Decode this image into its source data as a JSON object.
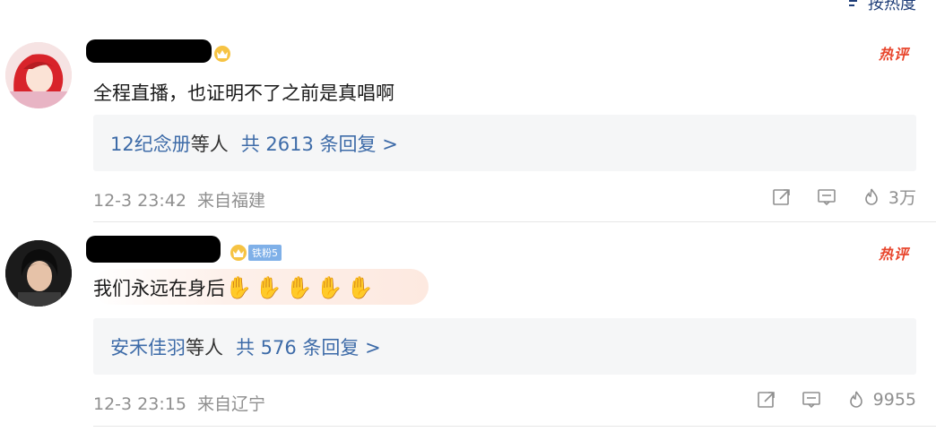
{
  "sort": {
    "label": "按热度"
  },
  "comments": [
    {
      "hot_label": "热评",
      "text": "全程直播，也证明不了之前是真唱啊",
      "reply_names": "12纪念册",
      "reply_suffix": "等人",
      "reply_count_label": "共 2613 条回复 >",
      "time": "12-3 23:42",
      "location": "来自福建",
      "likes": "3万"
    },
    {
      "hot_label": "热评",
      "fan_badge": "铁粉5",
      "text": "我们永远在身后",
      "emoji": "✋",
      "reply_names": "安禾佳羽",
      "reply_suffix": "等人",
      "reply_count_label": "共 576 条回复 >",
      "time": "12-3 23:15",
      "location": "来自辽宁",
      "likes": "9955"
    }
  ],
  "colors": {
    "link": "#3d6ba8",
    "hot": "#e8452c",
    "meta": "#8f8f8f",
    "reply_bg": "#f5f6f7"
  }
}
